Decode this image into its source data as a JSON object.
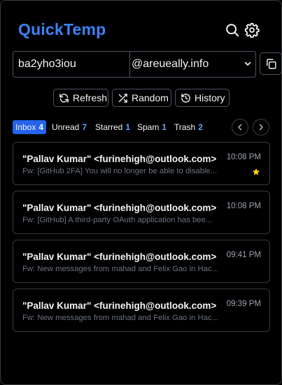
{
  "app": {
    "title": "QuickTemp"
  },
  "header": {
    "search_icon": "search-icon",
    "settings_icon": "gear-icon"
  },
  "address": {
    "username": "ba2yho3iou",
    "domain": "@areueally.info",
    "copy_icon": "copy-icon"
  },
  "actions": [
    {
      "label": "Refresh",
      "icon": "refresh-icon"
    },
    {
      "label": "Random",
      "icon": "shuffle-icon"
    },
    {
      "label": "History",
      "icon": "history-icon"
    }
  ],
  "tabs": [
    {
      "label": "Inbox",
      "count": "4",
      "active": true
    },
    {
      "label": "Unread",
      "count": "7"
    },
    {
      "label": "Starred",
      "count": "1"
    },
    {
      "label": "Spam",
      "count": "1"
    },
    {
      "label": "Trash",
      "count": "2"
    }
  ],
  "colors": {
    "accent": "#3b82f6",
    "active_tab": "#2563eb",
    "star": "#facc15"
  },
  "messages": [
    {
      "from": "\"Pallav Kumar\" <furinehigh@outlook.com>",
      "subject": "Fw: [GitHub 2FA] You will no longer be able to disable...",
      "time": "10:08 PM",
      "starred": true
    },
    {
      "from": "\"Pallav Kumar\" <furinehigh@outlook.com>",
      "subject": "Fw: [GitHub] A third-party OAuth application has bee...",
      "time": "10:08 PM",
      "starred": false
    },
    {
      "from": "\"Pallav Kumar\" <furinehigh@outlook.com>",
      "subject": "Fw: New messages from mahad and Felix Gao in Hac...",
      "time": "09:41 PM",
      "starred": false
    },
    {
      "from": "\"Pallav Kumar\" <furinehigh@outlook.com>",
      "subject": "Fw: New messages from mahad and Felix Gao in Hac...",
      "time": "09:39 PM",
      "starred": false
    }
  ]
}
